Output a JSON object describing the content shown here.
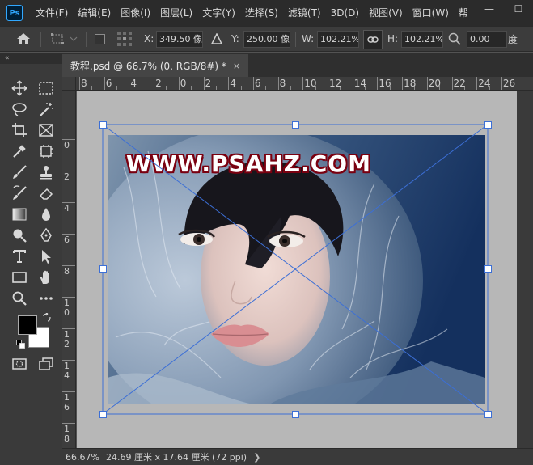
{
  "app": {
    "logo_text": "Ps"
  },
  "menu": [
    "文件(F)",
    "编辑(E)",
    "图像(I)",
    "图层(L)",
    "文字(Y)",
    "选择(S)",
    "滤镜(T)",
    "3D(D)",
    "视图(V)",
    "窗口(W)",
    "帮"
  ],
  "window_controls": {
    "minimize": "—",
    "maximize": "☐"
  },
  "options": {
    "x_label": "X:",
    "x_value": "349.50 像",
    "y_label": "Y:",
    "y_value": "250.00 像",
    "w_label": "W:",
    "w_value": "102.21%",
    "h_label": "H:",
    "h_value": "102.21%",
    "angle_value": "0.00",
    "angle_unit": "度"
  },
  "toolbar": {
    "collapse": "«"
  },
  "document": {
    "tab_title": "教程.psd @ 66.7% (0, RGB/8#) *",
    "close": "×"
  },
  "rulers": {
    "top": [
      "8",
      "6",
      "4",
      "2",
      "0",
      "2",
      "4",
      "6",
      "8",
      "10",
      "12",
      "14",
      "16",
      "18",
      "20",
      "22",
      "24",
      "26"
    ],
    "left": [
      "0",
      "2",
      "4",
      "6",
      "8",
      "1 0",
      "1 2",
      "1 4",
      "1 6",
      "1 8"
    ]
  },
  "image": {
    "watermark": "WWW.PSAHZ.COM"
  },
  "status": {
    "zoom": "66.67%",
    "info": "24.69 厘米 x 17.64 厘米 (72 ppi)",
    "arrow": "❯"
  },
  "colors": {
    "accent": "#31a8ff",
    "transform_line": "#3c6fd6",
    "watermark_outline": "#7a0010"
  }
}
